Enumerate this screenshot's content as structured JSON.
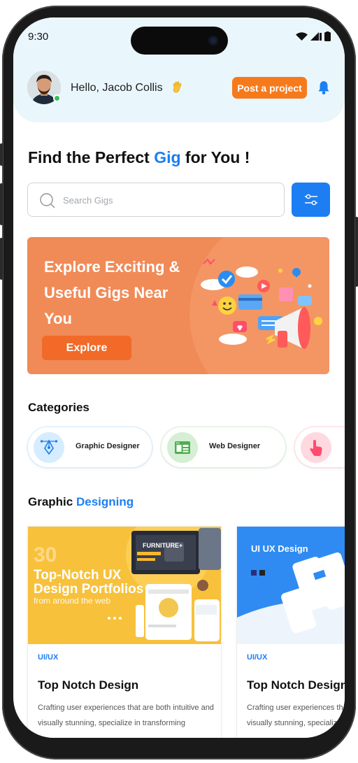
{
  "status_bar": {
    "time": "9:30"
  },
  "header": {
    "greeting": "Hello, Jacob Collis",
    "post_button": "Post a project"
  },
  "page_title": {
    "prefix": "Find the Perfect ",
    "accent": "Gig",
    "suffix": " for You !"
  },
  "search": {
    "placeholder": "Search Gigs"
  },
  "banner": {
    "text": "Explore Exciting & Useful Gigs Near You",
    "button": "Explore"
  },
  "categories": {
    "title": "Categories",
    "items": [
      {
        "label": "Graphic Designer",
        "icon": "pen-tool-icon"
      },
      {
        "label": "Web Designer",
        "icon": "web-layout-icon"
      },
      {
        "label": "",
        "icon": "tap-hand-icon"
      }
    ]
  },
  "gigs_section": {
    "prefix": "Graphic ",
    "accent": "Designing"
  },
  "gigs": [
    {
      "tag": "UI/UX",
      "title": "Top Notch Design",
      "desc": "Crafting user experiences that are both intuitive and visually stunning, specialize in transforming",
      "thumb": {
        "number": "30",
        "headline": "Top-Notch UX Design Portfolios",
        "sub": "from around the web",
        "mockup_label": "FURNITURE+"
      }
    },
    {
      "tag": "UI/UX",
      "title": "Top Notch Design",
      "desc": "Crafting user experiences that are both intuitive and visually stunning, specialize in transforming",
      "thumb": {
        "headline": "UI UX Design"
      }
    }
  ],
  "colors": {
    "accent": "#1c7ef2",
    "orange": "#f67a1c",
    "banner": "#f08a57",
    "header_bg": "#e9f6fc"
  }
}
